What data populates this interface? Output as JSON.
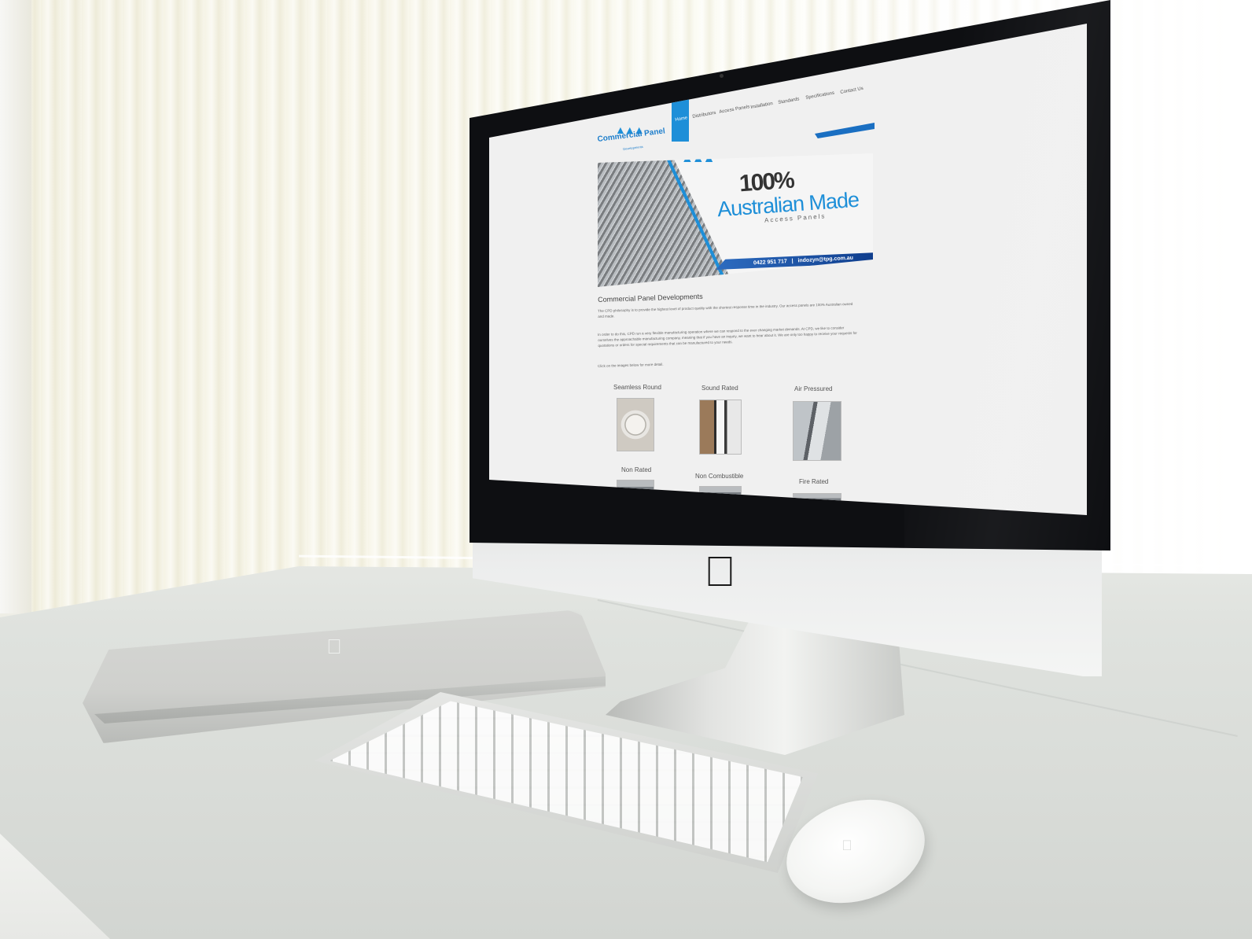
{
  "nav": {
    "items": [
      "Home",
      "Distributors",
      "Access Panels",
      "Installation",
      "Standards",
      "Specifications",
      "Contact Us"
    ],
    "active": "Home"
  },
  "logo": {
    "name": "Commercial Panel",
    "sub": "Developments"
  },
  "banner": {
    "percent": "100%",
    "title": "Australian Made",
    "subtitle": "Access Panels",
    "phone": "0422 951 717",
    "separator": "|",
    "email": "indozyn@tpg.com.au"
  },
  "content": {
    "title": "Commercial Panel Developments",
    "p1": "The CPD philosophy is to provide the highest level of product quality with the shortest response time in the industry. Our access panels are 100% Australian owned and made.",
    "p2": "In order to do this, CPD run a very flexible manufacturing operation where we can respond to the ever changing market demands. At CPD, we like to consider ourselves the approachable manufacturing company, meaning that if you have an inquiry, we want to hear about it. We are only too happy to receive your requests for quotations or orders for special requirements that can be manufactured to your needs.",
    "p3": "Click on the images below for more detail."
  },
  "products": [
    {
      "label": "Seamless Round"
    },
    {
      "label": "Sound Rated"
    },
    {
      "label": "Air Pressured"
    },
    {
      "label": "Non Rated"
    },
    {
      "label": "Non Combustible"
    },
    {
      "label": "Fire Rated"
    }
  ],
  "colors": {
    "accent": "#1e8fd8",
    "banner_bar": "#0f3d8c",
    "screen_bg": "#f0f0f0"
  },
  "icons": {
    "imac_logo": "apple-logo-icon",
    "laptop_logo": "apple-logo-icon",
    "mouse_logo": "apple-logo-icon"
  }
}
